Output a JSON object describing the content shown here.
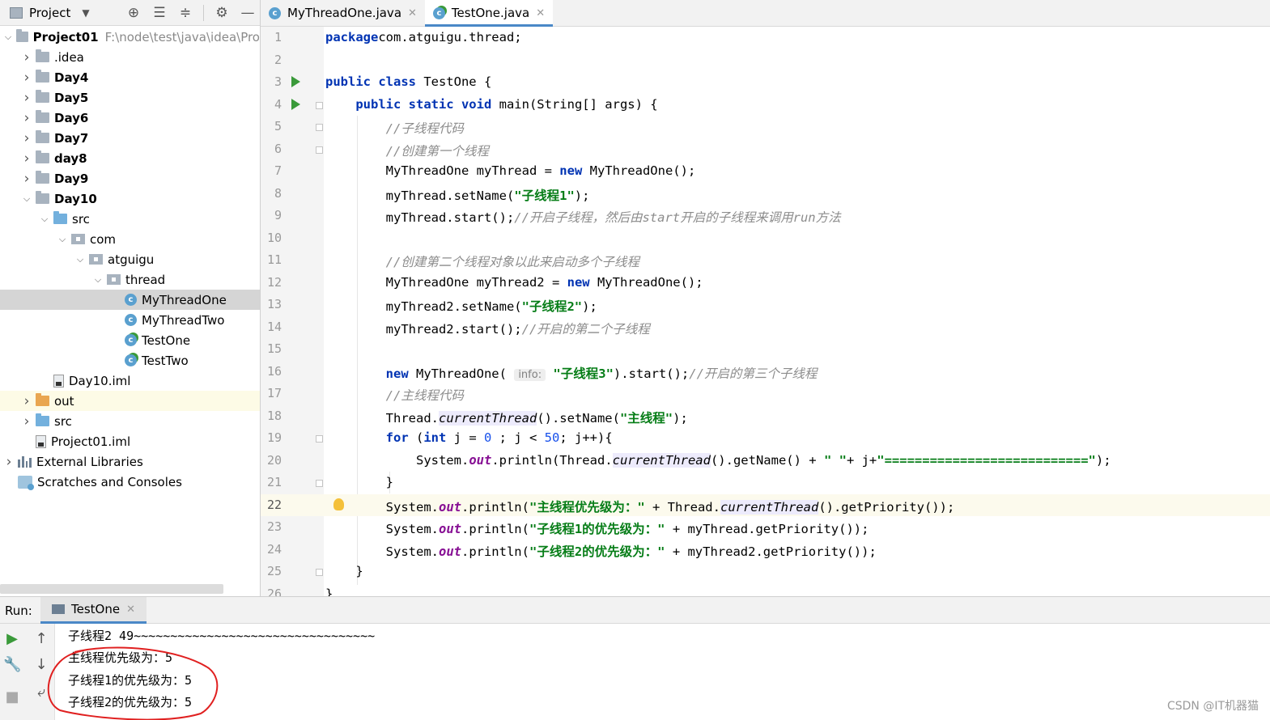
{
  "project_panel": {
    "title": "Project",
    "tree": [
      {
        "label": "Project01",
        "path": "F:\\node\\test\\java\\idea\\Pro",
        "depth": 0,
        "icon": "folder-icon",
        "expanded": true,
        "bold": true
      },
      {
        "label": ".idea",
        "depth": 1,
        "icon": "folder-icon",
        "expanded": false
      },
      {
        "label": "Day4",
        "depth": 1,
        "icon": "module-folder-icon",
        "expanded": false,
        "bold": true
      },
      {
        "label": "Day5",
        "depth": 1,
        "icon": "module-folder-icon",
        "expanded": false,
        "bold": true
      },
      {
        "label": "Day6",
        "depth": 1,
        "icon": "module-folder-icon",
        "expanded": false,
        "bold": true
      },
      {
        "label": "Day7",
        "depth": 1,
        "icon": "module-folder-icon",
        "expanded": false,
        "bold": true
      },
      {
        "label": "day8",
        "depth": 1,
        "icon": "module-folder-icon",
        "expanded": false,
        "bold": true
      },
      {
        "label": "Day9",
        "depth": 1,
        "icon": "module-folder-icon",
        "expanded": false,
        "bold": true
      },
      {
        "label": "Day10",
        "depth": 1,
        "icon": "module-folder-icon",
        "expanded": true,
        "bold": true
      },
      {
        "label": "src",
        "depth": 2,
        "icon": "source-folder-icon",
        "expanded": true
      },
      {
        "label": "com",
        "depth": 3,
        "icon": "package-icon",
        "expanded": true
      },
      {
        "label": "atguigu",
        "depth": 4,
        "icon": "package-icon",
        "expanded": true
      },
      {
        "label": "thread",
        "depth": 5,
        "icon": "package-icon",
        "expanded": true
      },
      {
        "label": "MyThreadOne",
        "depth": 6,
        "icon": "class-icon",
        "selected": true
      },
      {
        "label": "MyThreadTwo",
        "depth": 6,
        "icon": "class-icon"
      },
      {
        "label": "TestOne",
        "depth": 6,
        "icon": "runnable-class-icon"
      },
      {
        "label": "TestTwo",
        "depth": 6,
        "icon": "runnable-class-icon"
      },
      {
        "label": "Day10.iml",
        "depth": 2,
        "icon": "iml-file-icon"
      },
      {
        "label": "out",
        "depth": 1,
        "icon": "excluded-folder-icon",
        "expanded": false,
        "highlight": true
      },
      {
        "label": "src",
        "depth": 1,
        "icon": "source-folder-icon",
        "expanded": false
      },
      {
        "label": "Project01.iml",
        "depth": 1,
        "icon": "iml-file-icon"
      },
      {
        "label": "External Libraries",
        "depth": 0,
        "icon": "libraries-icon",
        "expanded": false
      },
      {
        "label": "Scratches and Consoles",
        "depth": 0,
        "icon": "scratches-icon"
      }
    ]
  },
  "editor": {
    "tabs": [
      {
        "label": "MyThreadOne.java",
        "active": false
      },
      {
        "label": "TestOne.java",
        "active": true
      }
    ],
    "current_line": 22,
    "lines": [
      {
        "n": "1",
        "tokens": [
          [
            "kw",
            "package"
          ],
          [
            "",
            "com.atguigu.thread;"
          ]
        ]
      },
      {
        "n": "2",
        "tokens": []
      },
      {
        "n": "3",
        "run": true,
        "tokens": [
          [
            "kw",
            "public class"
          ],
          [
            "",
            " TestOne {"
          ]
        ]
      },
      {
        "n": "4",
        "run": true,
        "fold": true,
        "tokens": [
          [
            "",
            "    "
          ],
          [
            "kw",
            "public static void"
          ],
          [
            "",
            " main(String[] args) {"
          ]
        ]
      },
      {
        "n": "5",
        "fold": true,
        "tokens": [
          [
            "",
            "        "
          ],
          [
            "cm",
            "//子线程代码"
          ]
        ]
      },
      {
        "n": "6",
        "fold": true,
        "tokens": [
          [
            "",
            "        "
          ],
          [
            "cm",
            "//创建第一个线程"
          ]
        ]
      },
      {
        "n": "7",
        "tokens": [
          [
            "",
            "        MyThreadOne myThread = "
          ],
          [
            "kw",
            "new"
          ],
          [
            "",
            " MyThreadOne();"
          ]
        ]
      },
      {
        "n": "8",
        "tokens": [
          [
            "",
            "        myThread.setName("
          ],
          [
            "str",
            "\"子线程1\""
          ],
          [
            "",
            ");"
          ]
        ]
      },
      {
        "n": "9",
        "tokens": [
          [
            "",
            "        myThread.start();"
          ],
          [
            "cm",
            "//开启子线程，然后由start开启的子线程来调用run方法"
          ]
        ]
      },
      {
        "n": "10",
        "tokens": []
      },
      {
        "n": "11",
        "tokens": [
          [
            "",
            "        "
          ],
          [
            "cm",
            "//创建第二个线程对象以此来启动多个子线程"
          ]
        ]
      },
      {
        "n": "12",
        "tokens": [
          [
            "",
            "        MyThreadOne myThread2 = "
          ],
          [
            "kw",
            "new"
          ],
          [
            "",
            " MyThreadOne();"
          ]
        ]
      },
      {
        "n": "13",
        "tokens": [
          [
            "",
            "        myThread2.setName("
          ],
          [
            "str",
            "\"子线程2\""
          ],
          [
            "",
            ");"
          ]
        ]
      },
      {
        "n": "14",
        "tokens": [
          [
            "",
            "        myThread2.start();"
          ],
          [
            "cm",
            "//开启的第二个子线程"
          ]
        ]
      },
      {
        "n": "15",
        "tokens": []
      },
      {
        "n": "16",
        "tokens": [
          [
            "",
            "        "
          ],
          [
            "kw",
            "new"
          ],
          [
            "",
            " MyThreadOne( "
          ],
          [
            "hint",
            "info:"
          ],
          [
            "",
            " "
          ],
          [
            "str",
            "\"子线程3\""
          ],
          [
            "",
            ").start();"
          ],
          [
            "cm",
            "//开启的第三个子线程"
          ]
        ]
      },
      {
        "n": "17",
        "tokens": [
          [
            "",
            "        "
          ],
          [
            "cm",
            "//主线程代码"
          ]
        ]
      },
      {
        "n": "18",
        "tokens": [
          [
            "",
            "        Thread."
          ],
          [
            "it hl",
            "currentThread"
          ],
          [
            "",
            "().setName("
          ],
          [
            "str",
            "\"主线程\""
          ],
          [
            "",
            ");"
          ]
        ]
      },
      {
        "n": "19",
        "fold": true,
        "tokens": [
          [
            "",
            "        "
          ],
          [
            "kw",
            "for"
          ],
          [
            "",
            " ("
          ],
          [
            "kw",
            "int"
          ],
          [
            "",
            " j = "
          ],
          [
            "num",
            "0"
          ],
          [
            "",
            " ; j < "
          ],
          [
            "num",
            "50"
          ],
          [
            "",
            "; j++){"
          ]
        ]
      },
      {
        "n": "20",
        "tokens": [
          [
            "",
            "            System."
          ],
          [
            "fld",
            "out"
          ],
          [
            "",
            ".println(Thread."
          ],
          [
            "it hl",
            "currentThread"
          ],
          [
            "",
            "().getName() + "
          ],
          [
            "str",
            "\" \""
          ],
          [
            "",
            "+ j+"
          ],
          [
            "str",
            "\"===========================\""
          ],
          [
            "",
            ");"
          ]
        ]
      },
      {
        "n": "21",
        "fold": true,
        "tokens": [
          [
            "",
            "        }"
          ]
        ]
      },
      {
        "n": "22",
        "bulb": true,
        "tokens": [
          [
            "",
            "        System."
          ],
          [
            "fld",
            "out"
          ],
          [
            "",
            ".println("
          ],
          [
            "str",
            "\"主线程优先级为：\""
          ],
          [
            "",
            " + Thread."
          ],
          [
            "it hl",
            "currentThread"
          ],
          [
            "",
            "().getPriority());"
          ]
        ]
      },
      {
        "n": "23",
        "tokens": [
          [
            "",
            "        System."
          ],
          [
            "fld",
            "out"
          ],
          [
            "",
            ".println("
          ],
          [
            "str",
            "\"子线程1的优先级为：\""
          ],
          [
            "",
            " + myThread.getPriority());"
          ]
        ]
      },
      {
        "n": "24",
        "tokens": [
          [
            "",
            "        System."
          ],
          [
            "fld",
            "out"
          ],
          [
            "",
            ".println("
          ],
          [
            "str",
            "\"子线程2的优先级为：\""
          ],
          [
            "",
            " + myThread2.getPriority());"
          ]
        ]
      },
      {
        "n": "25",
        "fold": true,
        "tokens": [
          [
            "",
            "    }"
          ]
        ]
      },
      {
        "n": "26",
        "tokens": [
          [
            "",
            "}"
          ]
        ]
      }
    ]
  },
  "run_panel": {
    "label": "Run:",
    "tab_label": "TestOne",
    "output": [
      "子线程2 49~~~~~~~~~~~~~~~~~~~~~~~~~~~~~~~~~",
      "主线程优先级为：5",
      "子线程1的优先级为：5",
      "子线程2的优先级为：5"
    ]
  },
  "watermark": "CSDN @IT机器猫",
  "colors": {
    "keyword": "#0033b3",
    "string": "#067d17",
    "comment": "#8c8c8c",
    "number": "#1750eb",
    "field": "#871094",
    "accent": "#4a88c7",
    "annotation": "#e02020"
  }
}
